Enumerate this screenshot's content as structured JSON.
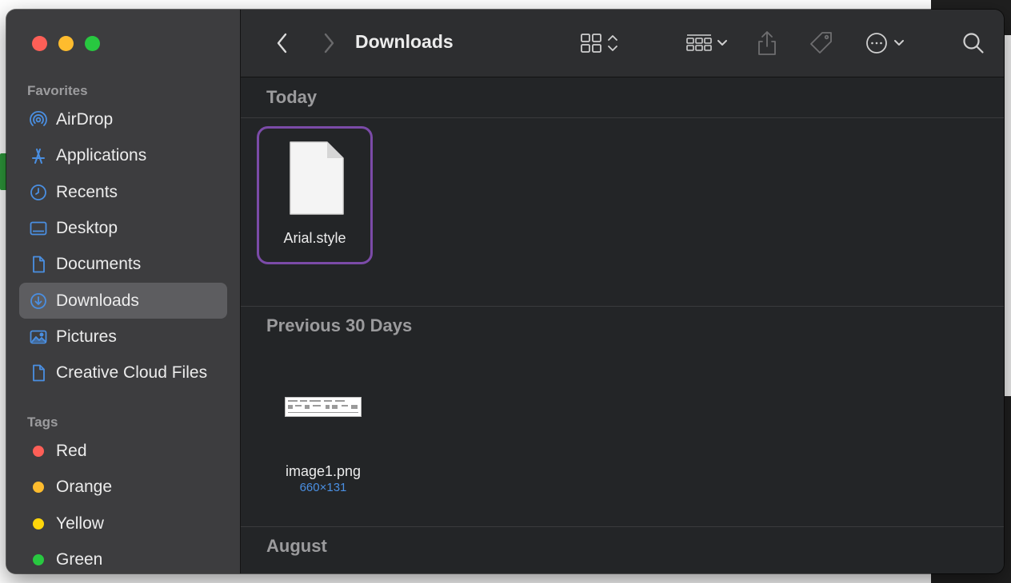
{
  "window": {
    "title": "Downloads"
  },
  "toolbar": {
    "back_icon": "chevron-left-icon",
    "forward_icon": "chevron-right-icon",
    "view_icon": "grid-view-icon",
    "group_icon": "group-by-icon",
    "share_icon": "share-icon",
    "tag_icon": "tag-icon",
    "more_icon": "ellipsis-circle-icon",
    "search_icon": "search-icon"
  },
  "sidebar": {
    "favorites_header": "Favorites",
    "favorites": [
      {
        "label": "AirDrop",
        "icon": "airdrop-icon"
      },
      {
        "label": "Applications",
        "icon": "applications-icon"
      },
      {
        "label": "Recents",
        "icon": "clock-icon"
      },
      {
        "label": "Desktop",
        "icon": "desktop-icon"
      },
      {
        "label": "Documents",
        "icon": "document-icon"
      },
      {
        "label": "Downloads",
        "icon": "download-icon",
        "selected": true
      },
      {
        "label": "Pictures",
        "icon": "photo-icon"
      },
      {
        "label": "Creative Cloud Files",
        "icon": "file-icon"
      }
    ],
    "tags_header": "Tags",
    "tags": [
      {
        "label": "Red",
        "color": "#fe5f57"
      },
      {
        "label": "Orange",
        "color": "#febc2e"
      },
      {
        "label": "Yellow",
        "color": "#ffd60a"
      },
      {
        "label": "Green",
        "color": "#28c840"
      }
    ]
  },
  "content": {
    "groups": [
      {
        "header": "Today",
        "files": [
          {
            "name": "Arial.style",
            "selected": true
          }
        ]
      },
      {
        "header": "Previous 30 Days",
        "files": [
          {
            "name": "image1.png",
            "dimensions": "660×131"
          }
        ]
      },
      {
        "header": "August",
        "files": []
      }
    ]
  },
  "colors": {
    "accent": "#4a8fe2",
    "selection_ring": "#7b4ba8",
    "sidebar_bg": "#3d3d3f",
    "content_bg": "#232527"
  }
}
